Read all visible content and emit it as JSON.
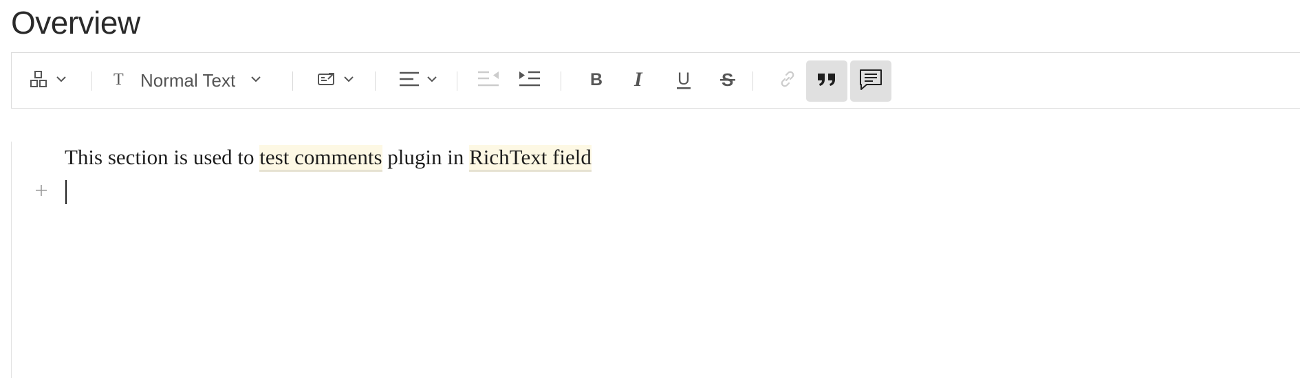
{
  "page": {
    "title": "Overview"
  },
  "toolbar": {
    "text_style_label": "Normal Text",
    "icons": {
      "insert": "blocks-icon",
      "text_style": "text-type-icon",
      "embed": "embed-icon",
      "align": "align-left-icon",
      "outdent": "outdent-icon",
      "indent": "indent-icon",
      "bold": "bold-icon",
      "italic": "italic-icon",
      "underline": "underline-icon",
      "strike": "strikethrough-icon",
      "link": "link-icon",
      "quote": "quote-icon",
      "comment": "comment-icon"
    },
    "active_buttons": [
      "quote",
      "comment"
    ],
    "disabled_buttons": [
      "outdent",
      "link"
    ]
  },
  "editor": {
    "paragraph": {
      "part1": "This section is used to ",
      "highlight1": "test comments",
      "part2": " plugin in ",
      "highlight2": "RichText field"
    },
    "highlight_color": "#fdf8e4"
  },
  "colors": {
    "icon": "#555555",
    "icon_disabled": "#c8c8c8",
    "active_background": "#e0e0e0"
  }
}
